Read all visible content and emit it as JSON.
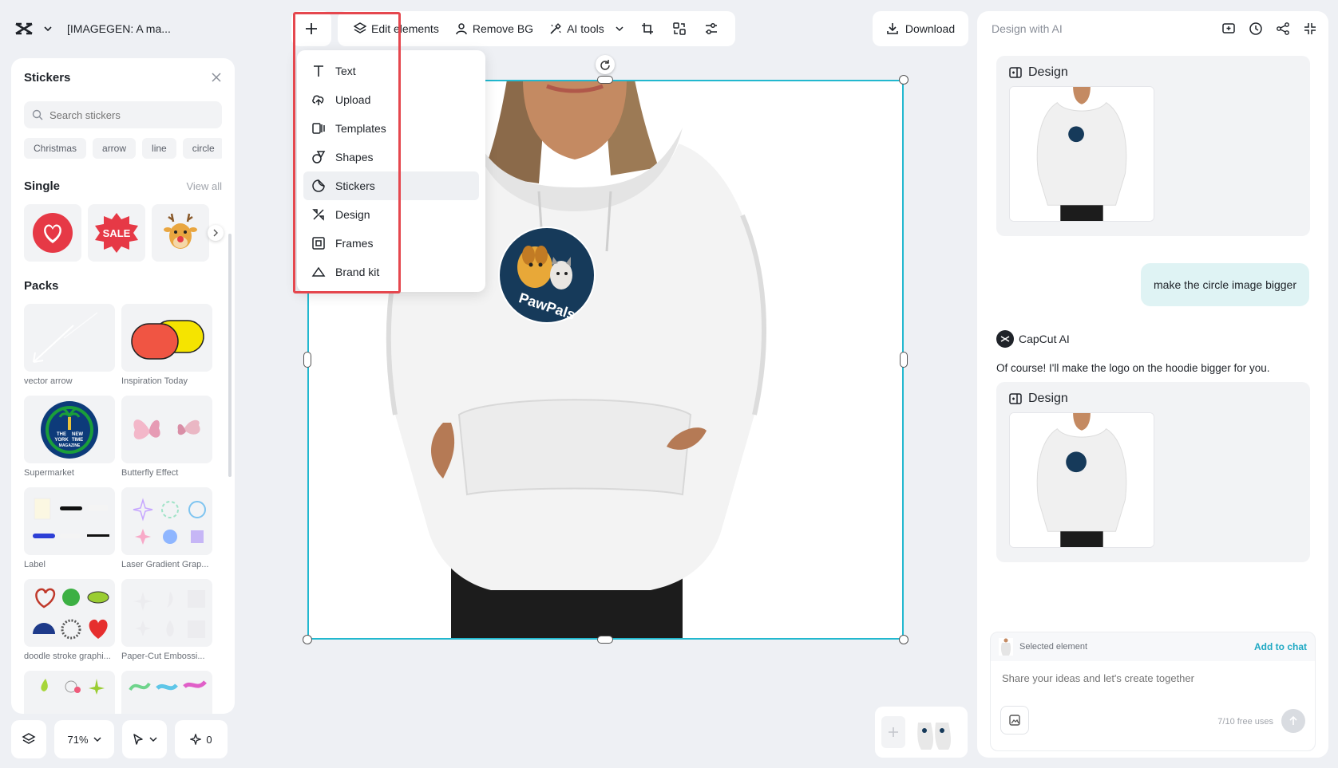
{
  "header": {
    "project_title": "[IMAGEGEN: A ma..."
  },
  "stickers_panel": {
    "title": "Stickers",
    "search_placeholder": "Search stickers",
    "chips": [
      "Christmas",
      "arrow",
      "line",
      "circle"
    ],
    "single": {
      "title": "Single",
      "view_all": "View all",
      "items": [
        "heart-sticker",
        "sale-sticker",
        "reindeer-sticker"
      ],
      "sale_text": "SALE"
    },
    "packs": {
      "title": "Packs",
      "items": [
        {
          "label": "vector arrow"
        },
        {
          "label": "Inspiration Today"
        },
        {
          "label": "Supermarket",
          "logo_text": [
            "THE",
            "NEW",
            "YORK",
            "TIME",
            "MAGAZINE"
          ]
        },
        {
          "label": "Butterfly Effect"
        },
        {
          "label": "Label"
        },
        {
          "label": "Laser Gradient Grap..."
        },
        {
          "label": "doodle stroke graphi..."
        },
        {
          "label": "Paper-Cut Embossi..."
        }
      ]
    }
  },
  "bottom_controls": {
    "zoom": "71%",
    "count": "0"
  },
  "toolbar": {
    "edit_elements": "Edit elements",
    "remove_bg": "Remove BG",
    "ai_tools": "AI tools",
    "download": "Download"
  },
  "add_menu": {
    "items": [
      "Text",
      "Upload",
      "Templates",
      "Shapes",
      "Stickers",
      "Design",
      "Frames",
      "Brand kit"
    ],
    "active": "Stickers"
  },
  "canvas": {
    "logo_text": "PawPals"
  },
  "ai_panel": {
    "title": "Design with AI",
    "card_title": "Design",
    "user_message": "make the circle image bigger",
    "assistant_name": "CapCut AI",
    "assistant_message": "Of course! I'll make the logo on the hoodie bigger for you.",
    "composer": {
      "selected_label": "Selected element",
      "add_to_chat": "Add to chat",
      "placeholder": "Share your ideas and let's create together",
      "free_uses": "7/10 free uses"
    }
  },
  "colors": {
    "accent": "#22b8cf",
    "highlight": "#e5474e",
    "user_bubble": "#dff3f4"
  }
}
